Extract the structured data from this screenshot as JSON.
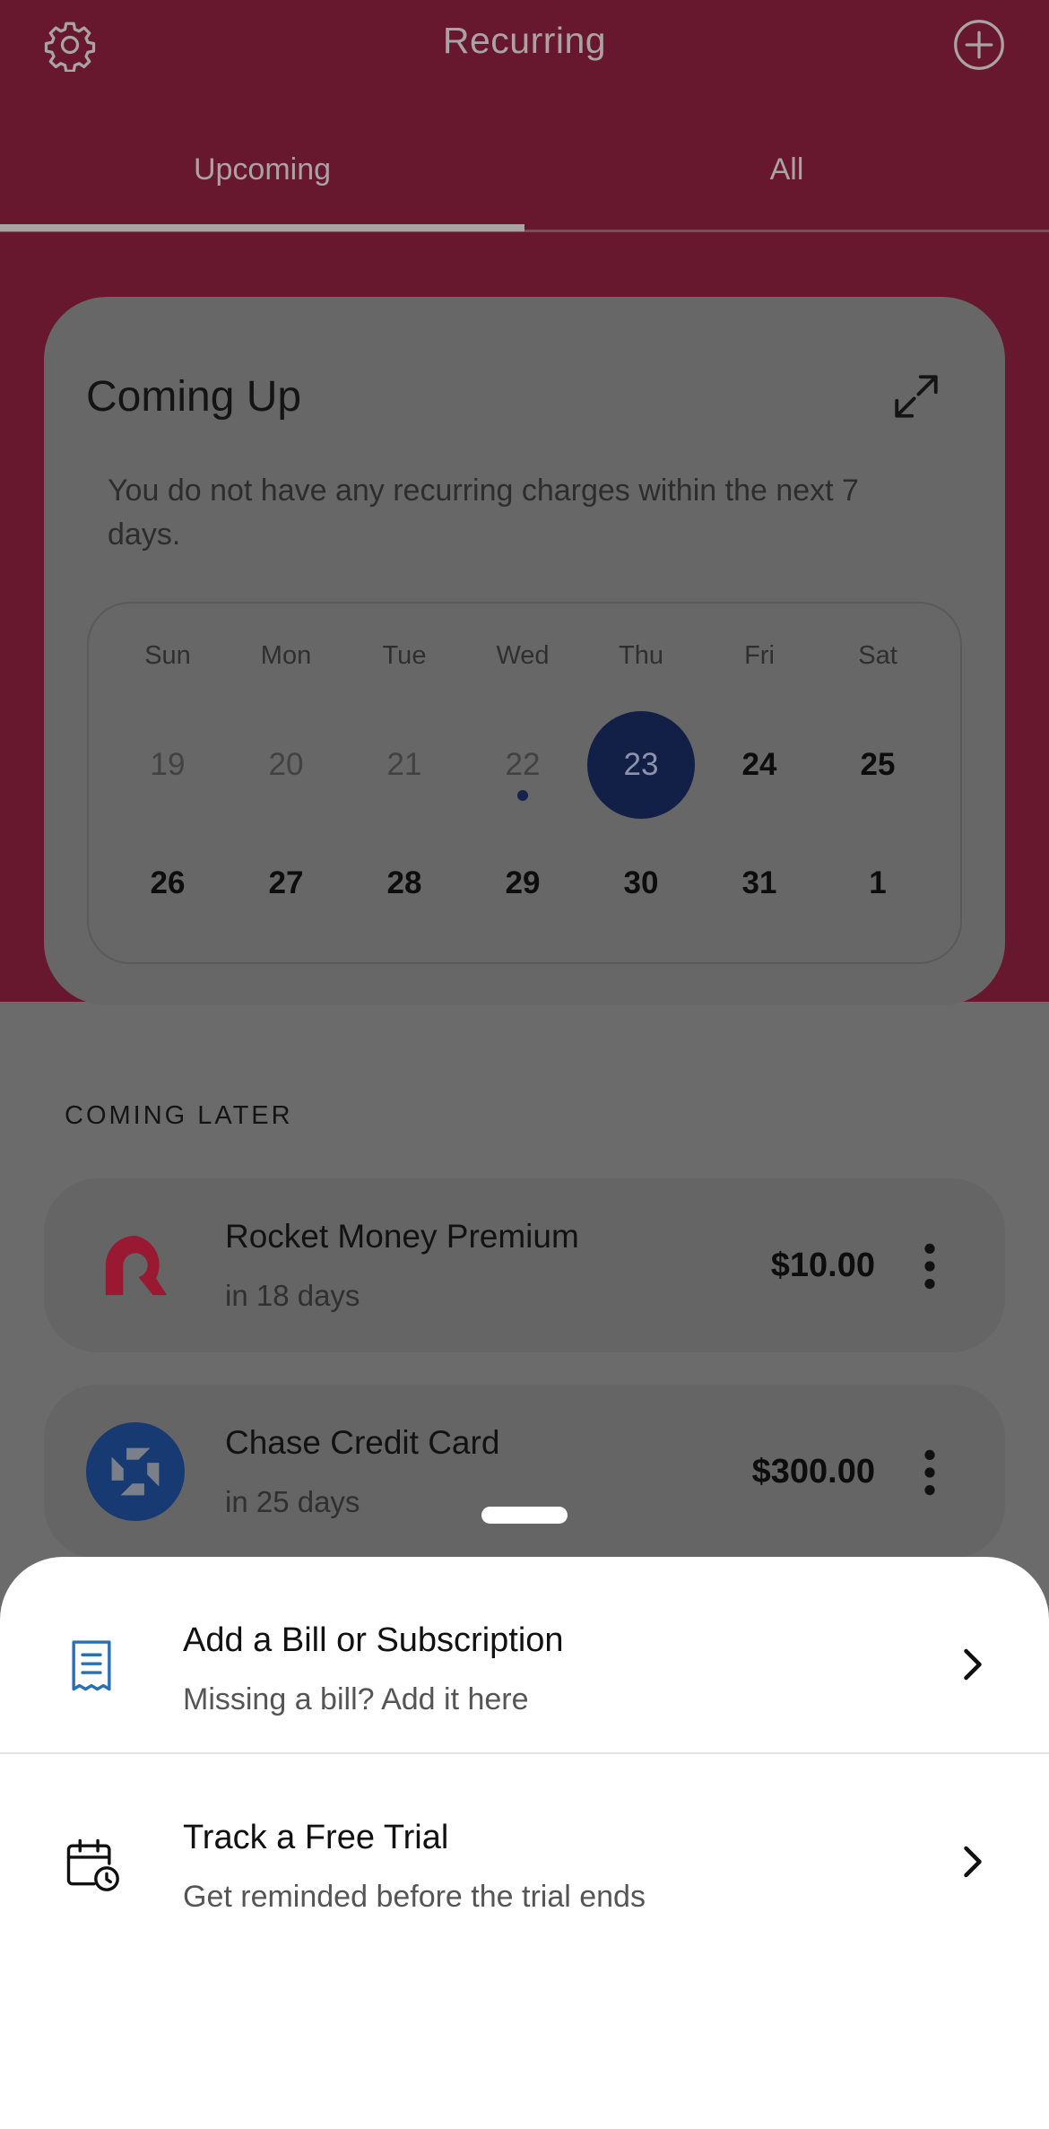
{
  "header": {
    "title": "Recurring"
  },
  "tabs": [
    {
      "label": "Upcoming",
      "active": true
    },
    {
      "label": "All",
      "active": false
    }
  ],
  "coming_up": {
    "title": "Coming Up",
    "message": "You do not have any recurring charges within the next 7 days.",
    "weekdays": [
      "Sun",
      "Mon",
      "Tue",
      "Wed",
      "Thu",
      "Fri",
      "Sat"
    ],
    "week1": [
      "19",
      "20",
      "21",
      "22",
      "23",
      "24",
      "25"
    ],
    "week2": [
      "26",
      "27",
      "28",
      "29",
      "30",
      "31",
      "1"
    ],
    "today": "23",
    "event_day": "22"
  },
  "coming_later": {
    "label": "COMING LATER",
    "items": [
      {
        "name": "Rocket Money Premium",
        "due": "in 18 days",
        "amount": "$10.00",
        "icon": "rocket-money-logo"
      },
      {
        "name": "Chase Credit Card",
        "due": "in 25 days",
        "amount": "$300.00",
        "icon": "chase-logo"
      }
    ]
  },
  "sheet": {
    "options": [
      {
        "title": "Add a Bill or Subscription",
        "subtitle": "Missing a bill? Add it here",
        "icon": "receipt-icon"
      },
      {
        "title": "Track a Free Trial",
        "subtitle": "Get reminded before the trial ends",
        "icon": "calendar-clock-icon"
      }
    ]
  },
  "colors": {
    "brand": "#67182f",
    "today": "#122048",
    "chase": "#173a73",
    "rocket": "#9a1932",
    "receipt_icon": "#2a6fb0"
  }
}
